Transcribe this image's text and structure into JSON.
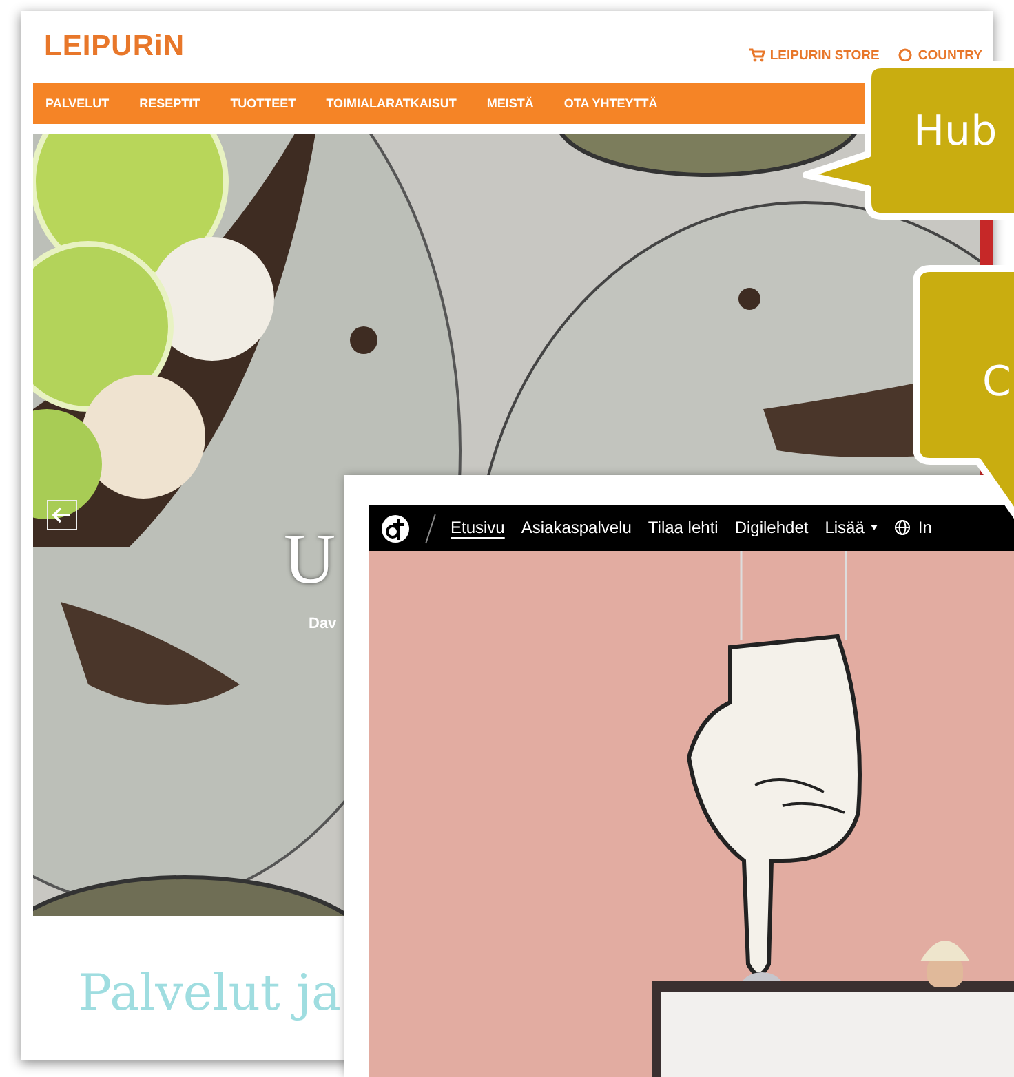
{
  "leipurin": {
    "logo": "LEIPURiN",
    "store_link": "LEIPURIN STORE",
    "country_link": "COUNTRY",
    "nav": [
      {
        "label": "PALVELUT"
      },
      {
        "label": "RESEPTIT"
      },
      {
        "label": "TUOTTEET"
      },
      {
        "label": "TOIMIALARATKAISUT"
      },
      {
        "label": "MEISTÄ"
      },
      {
        "label": "OTA YHTEYTTÄ"
      }
    ],
    "hero": {
      "title": "U",
      "subtitle": "Dav"
    },
    "section_heading": "Palvelut ja"
  },
  "magazine": {
    "nav": [
      {
        "label": "Etusivu",
        "selected": true,
        "kind": "link"
      },
      {
        "label": "Asiakaspalvelu",
        "selected": false,
        "kind": "link"
      },
      {
        "label": "Tilaa lehti",
        "selected": false,
        "kind": "link"
      },
      {
        "label": "Digilehdet",
        "selected": false,
        "kind": "link"
      },
      {
        "label": "Lisää",
        "selected": false,
        "kind": "dropdown"
      }
    ],
    "language": "In"
  },
  "callouts": [
    {
      "text": "Hub",
      "kind": "left"
    },
    {
      "text": "C",
      "kind": "down"
    }
  ]
}
